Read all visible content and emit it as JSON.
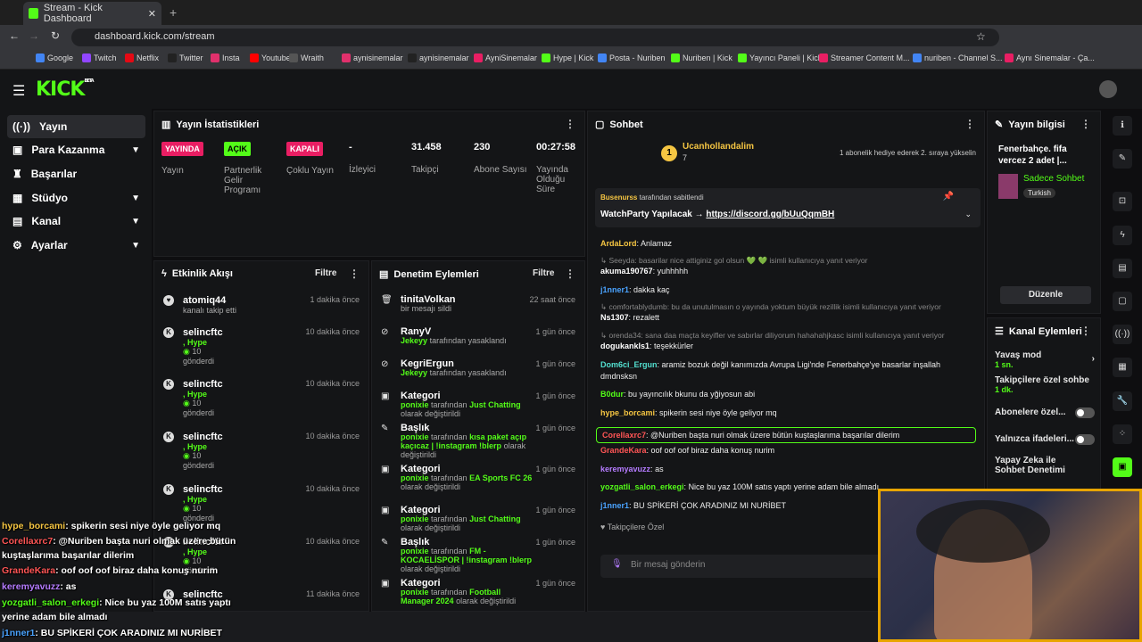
{
  "browser": {
    "tab_title": "Stream - Kick Dashboard",
    "url": "dashboard.kick.com/stream",
    "bookmarks": [
      "Google",
      "Twitch",
      "Netflix",
      "Twitter",
      "Insta",
      "Youtube",
      "Wraith",
      "aynisinemalar",
      "aynisinemalar",
      "AyniSinemalar",
      "Hype | Kick",
      "Posta - Nuriben",
      "Nuriben | Kick",
      "Yayıncı Paneli | Kick",
      "Streamer Content M...",
      "nuriben - Channel S...",
      "Aynı Sinemalar - Ça..."
    ]
  },
  "logo": "KICK",
  "logo_beta": "BETA",
  "sidebar": [
    {
      "label": "Yayın"
    },
    {
      "label": "Para Kazanma"
    },
    {
      "label": "Başarılar"
    },
    {
      "label": "Stüdyo"
    },
    {
      "label": "Kanal"
    },
    {
      "label": "Ayarlar"
    }
  ],
  "stats": {
    "title": "Yayın İstatistikleri",
    "items": [
      {
        "badge": "YAYINDA",
        "label": "Yayın",
        "color": "#e91e63"
      },
      {
        "badge": "AÇIK",
        "label": "Partnerlik Gelir Programı",
        "color": "#53fc18"
      },
      {
        "badge": "KAPALI",
        "label": "Çoklu Yayın",
        "color": "#e91e63"
      },
      {
        "value": "-",
        "label": "İzleyici"
      },
      {
        "value": "31.458",
        "label": "Takipçi"
      },
      {
        "value": "230",
        "label": "Abone Sayısı"
      },
      {
        "value": "00:27:58",
        "label": "Yayında Olduğu Süre"
      }
    ]
  },
  "activity": {
    "title": "Etkinlik Akışı",
    "filter": "Filtre",
    "items": [
      {
        "name": "atomiq44",
        "sub": "kanalı takip etti",
        "time": "1 dakika önce"
      },
      {
        "name": "selincftc",
        "sub1": ", Hype",
        "amount": "10",
        "sub2": "gönderdi",
        "time": "10 dakika önce"
      },
      {
        "name": "selincftc",
        "sub1": ", Hype",
        "amount": "10",
        "sub2": "gönderdi",
        "time": "10 dakika önce"
      },
      {
        "name": "selincftc",
        "sub1": ", Hype",
        "amount": "10",
        "sub2": "gönderdi",
        "time": "10 dakika önce"
      },
      {
        "name": "selincftc",
        "sub1": ", Hype",
        "amount": "10",
        "sub2": "gönderdi",
        "time": "10 dakika önce"
      },
      {
        "name": "selincftc",
        "sub1": ", Hype",
        "amount": "10",
        "sub2": "gönderdi",
        "time": "10 dakika önce"
      },
      {
        "name": "selincftc",
        "time": "11 dakika önce"
      }
    ]
  },
  "moderation": {
    "title": "Denetim Eylemleri",
    "filter": "Filtre",
    "items": [
      {
        "name": "tinitaVolkan",
        "sub": "bir mesajı sildi",
        "time": "22 saat önce"
      },
      {
        "name": "RanyV",
        "actor": "Jekeyy",
        "sub": "tarafından yasaklandı",
        "time": "1 gün önce"
      },
      {
        "name": "KegriErgun",
        "actor": "Jekeyy",
        "sub": "tarafından yasaklandı",
        "time": "1 gün önce"
      },
      {
        "name": "Kategori",
        "actor": "ponixie",
        "sub": "tarafından",
        "hl": "Just Chatting",
        "sub2": "olarak değiştirildi",
        "time": "1 gün önce"
      },
      {
        "name": "Başlık",
        "actor": "ponixie",
        "sub": "tarafından",
        "hl": "kısa paket açıp kaçıcaz | !instagram !blerp",
        "sub2": "olarak değiştirildi",
        "time": "1 gün önce"
      },
      {
        "name": "Kategori",
        "actor": "ponixie",
        "sub": "tarafından",
        "hl": "EA Sports FC 26",
        "sub2": "olarak değiştirildi",
        "time": "1 gün önce"
      },
      {
        "name": "Kategori",
        "actor": "ponixie",
        "sub": "tarafından",
        "hl": "Just Chatting",
        "sub2": "olarak değiştirildi",
        "time": "1 gün önce"
      },
      {
        "name": "Başlık",
        "actor": "ponixie",
        "sub": "tarafından",
        "hl": "FM - KOCAELİSPOR | !instagram !blerp",
        "sub2": "olarak değiştirildi",
        "time": "1 gün önce"
      },
      {
        "name": "Kategori",
        "actor": "ponixie",
        "sub": "tarafından",
        "hl": "Football Manager 2024",
        "sub2": "olarak değiştirildi",
        "time": "1 gün önce"
      }
    ]
  },
  "chat": {
    "title": "Sohbet",
    "top_user": "Ucanhollandalim",
    "top_count": "7",
    "top_msg": "1 abonelik hediye ederek 2. sıraya yükselin",
    "pinned_by": "Busenurss",
    "pinned_suffix": "tarafından sabitlendi",
    "pinned_text": "WatchParty Yapılacak →",
    "pinned_link": "https://discord.gg/bUuQqmBH",
    "messages": [
      {
        "user": "ArdaLord",
        "text": "Anlamaz",
        "color": "#f5c542"
      },
      {
        "reply": "Seeyda: basarilar nice attiginiz gol olsun 💚 💚 isimli kullanıcıya yanıt veriyor"
      },
      {
        "user": "akuma190767",
        "text": "yuhhhhh",
        "color": "#fff"
      },
      {
        "user": "j1nner1",
        "text": "dakka kaç",
        "color": "#4aa3ff"
      },
      {
        "reply": "comfortablydumb: bu da unutulmasın o yayında yoktum büyük rezillik isimli kullanıcıya yanıt veriyor"
      },
      {
        "user": "Ns1307",
        "text": "rezalett",
        "color": "#fff"
      },
      {
        "reply": "orenda34: sana daa maçta keyifler ve sabırlar diliyorum hahahahjkasc isimli kullanıcıya yanıt veriyor"
      },
      {
        "user": "dogukankls1",
        "text": "teşekkürler",
        "color": "#fff"
      },
      {
        "user": "Dom6ci_Ergun",
        "text": "aramiz bozuk değil kanımızda Avrupa Ligi'nde Fenerbahçe'ye basarlar inşallah dmdnsksn",
        "color": "#53e0d0"
      },
      {
        "user": "B0dur",
        "text": "bu yayıncılık bkunu da yğiyosun abi",
        "color": "#53fc18"
      },
      {
        "user": "hype_borcami",
        "text": "spikerin sesi niye öyle geliyor mq",
        "color": "#f5c542"
      },
      {
        "user": "Corellaxrc7",
        "text": "@Nuriben başta nuri olmak üzere bütün kuştaşlarıma başarılar dilerim",
        "color": "#ff5555"
      },
      {
        "user": "GrandeKara",
        "text": "oof oof oof biraz daha konuş nurim",
        "color": "#ff5555"
      },
      {
        "user": "keremyavuzz",
        "text": "as",
        "color": "#b57cff"
      },
      {
        "user": "yozgatli_salon_erkegi",
        "text": "Nice bu yaz 100M satıs yaptı yerine adam bile almadı",
        "color": "#53fc18"
      },
      {
        "user": "j1nner1",
        "text": "BU SPİKERİ ÇOK ARADINIZ MI NURİBET",
        "color": "#4aa3ff"
      }
    ],
    "emote_label": "Takipçilere Özel",
    "input_placeholder": "Bir mesaj gönderin"
  },
  "info": {
    "title": "Yayın bilgisi",
    "stream_title": "Fenerbahçe. fifa vercez 2 adet |...",
    "category": "Sadece Sohbet",
    "language": "Turkish",
    "edit": "Düzenle"
  },
  "actions": {
    "title": "Kanal Eylemleri",
    "items": [
      {
        "label": "Yavaş mod",
        "value": "1 sn."
      },
      {
        "label": "Takipçilere özel sohbe",
        "value": "1 dk."
      },
      {
        "label": "Abonelere özel..."
      },
      {
        "label": "Yalnızca ifadeleri..."
      },
      {
        "label": "Yapay Zeka ile Sohbet Denetimi"
      }
    ]
  },
  "overlay": [
    {
      "user": "hype_borcami",
      "text": ": spikerin sesi niye öyle geliyor mq",
      "color": "#f5c542"
    },
    {
      "user": "Corellaxrc7",
      "text": ": @Nuriben başta nuri olmak üzere bütün",
      "color": "#ff5555"
    },
    {
      "user": "",
      "text": "kuştaşlarıma başarılar dilerim",
      "color": "#fff"
    },
    {
      "user": "GrandeKara",
      "text": ": oof oof oof biraz daha konuş nurim",
      "color": "#ff5555"
    },
    {
      "user": "keremyavuzz",
      "text": ": as",
      "color": "#b57cff"
    },
    {
      "user": "yozgatli_salon_erkegi",
      "text": ": Nice bu yaz 100M satıs yaptı",
      "color": "#53fc18"
    },
    {
      "user": "",
      "text": "yerine adam bile almadı",
      "color": "#fff"
    },
    {
      "user": "j1nner1",
      "text": ": BU SPİKERİ ÇOK ARADINIZ MI NURİBET",
      "color": "#4aa3ff"
    }
  ]
}
